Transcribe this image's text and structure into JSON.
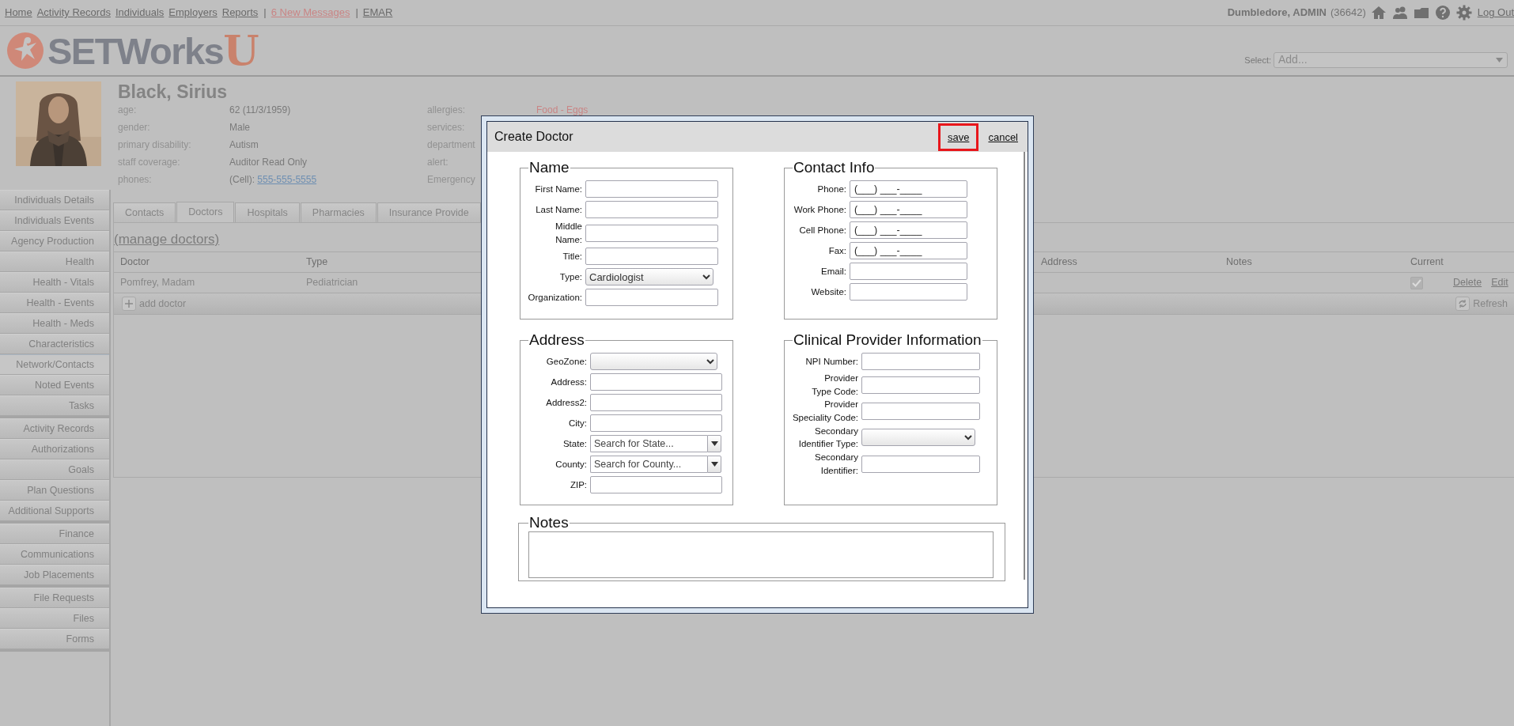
{
  "top_nav": {
    "links": [
      {
        "label": "Home",
        "kind": "link"
      },
      {
        "label": "Activity Records",
        "kind": "link"
      },
      {
        "label": "Individuals",
        "kind": "link"
      },
      {
        "label": "Employers",
        "kind": "link"
      },
      {
        "label": "Reports",
        "kind": "link"
      },
      {
        "label": "|",
        "kind": "separator"
      },
      {
        "label": "6 New Messages",
        "kind": "alert"
      },
      {
        "label": "|",
        "kind": "separator"
      },
      {
        "label": "EMAR",
        "kind": "link"
      }
    ],
    "user": "Dumbledore, ADMIN",
    "user_id": "(36642)",
    "logout": "Log Out"
  },
  "header": {
    "logo_text": "SETWorks",
    "logo_mark": "U",
    "select_label": "Select:",
    "select_placeholder": "Add..."
  },
  "profile": {
    "name": "Black, Sirius",
    "details": [
      {
        "label": "age:",
        "value": "62 (11/3/1959)"
      },
      {
        "label": "gender:",
        "value": "Male"
      },
      {
        "label": "primary disability:",
        "value": "Autism"
      },
      {
        "label": "staff coverage:",
        "value": "Auditor Read Only"
      },
      {
        "label": "phones:",
        "value": "(Cell):",
        "link": "555-555-5555"
      }
    ],
    "details_2": [
      {
        "label": "allergies:",
        "value": "Food - Eggs",
        "kind": "alert"
      },
      {
        "label": "services:"
      },
      {
        "label": "department"
      },
      {
        "label": "alert:"
      },
      {
        "label": "Emergency"
      }
    ]
  },
  "sidebar": {
    "groups": [
      {
        "items": [
          {
            "label": "Individuals Details",
            "selected": false
          },
          {
            "label": "Individuals Events",
            "selected": false
          },
          {
            "label": "Agency Production",
            "selected": false
          },
          {
            "label": "Health",
            "selected": false
          },
          {
            "label": "Health - Vitals",
            "selected": false
          },
          {
            "label": "Health - Events",
            "selected": false
          },
          {
            "label": "Health - Meds",
            "selected": false
          },
          {
            "label": "Characteristics",
            "selected": false
          },
          {
            "label": "Network/Contacts",
            "selected": true
          },
          {
            "label": "Noted Events",
            "selected": false
          },
          {
            "label": "Tasks",
            "selected": false
          }
        ]
      },
      {
        "items": [
          {
            "label": "Activity Records",
            "selected": false
          },
          {
            "label": "Authorizations",
            "selected": false
          },
          {
            "label": "Goals",
            "selected": false
          },
          {
            "label": "Plan Questions",
            "selected": false
          },
          {
            "label": "Additional Supports",
            "selected": false
          }
        ]
      },
      {
        "items": [
          {
            "label": "Finance",
            "selected": false
          },
          {
            "label": "Communications",
            "selected": false
          },
          {
            "label": "Job Placements",
            "selected": false
          }
        ]
      },
      {
        "items": [
          {
            "label": "File Requests",
            "selected": false
          },
          {
            "label": "Files",
            "selected": false
          },
          {
            "label": "Forms",
            "selected": false
          }
        ]
      }
    ]
  },
  "tabs": [
    {
      "label": "Contacts",
      "selected": false
    },
    {
      "label": "Doctors",
      "selected": true
    },
    {
      "label": "Hospitals",
      "selected": false
    },
    {
      "label": "Pharmacies",
      "selected": false
    },
    {
      "label": "Insurance Provide",
      "selected": false
    }
  ],
  "manage_link": "(manage doctors)",
  "table": {
    "columns": [
      {
        "label": "Doctor"
      },
      {
        "label": "Type"
      },
      {
        "label": "Address"
      },
      {
        "label": "Notes"
      },
      {
        "label": "Current"
      }
    ],
    "rows": [
      {
        "doctor": "Pomfrey, Madam",
        "type": "Pediatrician",
        "current": true,
        "actions": [
          "Delete",
          "Edit"
        ]
      }
    ],
    "add_label": "add doctor",
    "refresh_label": "Refresh"
  },
  "dialog": {
    "title": "Create Doctor",
    "actions": [
      {
        "label": "save",
        "highlighted": true
      },
      {
        "label": "cancel",
        "highlighted": false
      }
    ],
    "sections": [
      {
        "title": "Name",
        "fields": [
          {
            "label": "First Name:",
            "kind": "text"
          },
          {
            "label": "Last Name:",
            "kind": "text"
          },
          {
            "label": "Middle\nName:",
            "kind": "text"
          },
          {
            "label": "Title:",
            "kind": "text"
          },
          {
            "label": "Type:",
            "kind": "select",
            "value": "Cardiologist"
          },
          {
            "label": "Organization:",
            "kind": "text"
          }
        ]
      },
      {
        "title": "Contact Info",
        "fields": [
          {
            "label": "Phone:",
            "kind": "phone",
            "value": "(___) ___-____"
          },
          {
            "label": "Work Phone:",
            "kind": "phone",
            "value": "(___) ___-____"
          },
          {
            "label": "Cell Phone:",
            "kind": "phone",
            "value": "(___) ___-____"
          },
          {
            "label": "Fax:",
            "kind": "phone",
            "value": "(___) ___-____"
          },
          {
            "label": "Email:",
            "kind": "text"
          },
          {
            "label": "Website:",
            "kind": "text"
          }
        ]
      },
      {
        "title": "Address",
        "fields": [
          {
            "label": "GeoZone:",
            "kind": "select"
          },
          {
            "label": "Address:",
            "kind": "text"
          },
          {
            "label": "Address2:",
            "kind": "text"
          },
          {
            "label": "City:",
            "kind": "text"
          },
          {
            "label": "State:",
            "kind": "combo",
            "placeholder": "Search for State..."
          },
          {
            "label": "County:",
            "kind": "combo",
            "placeholder": "Search for County..."
          },
          {
            "label": "ZIP:",
            "kind": "text"
          }
        ]
      },
      {
        "title": "Clinical Provider Information",
        "fields": [
          {
            "label": "NPI Number:",
            "kind": "text"
          },
          {
            "label": "Provider\nType Code:",
            "kind": "text"
          },
          {
            "label": "Provider\nSpeciality Code:",
            "kind": "text"
          },
          {
            "label": "Secondary\nIdentifier Type:",
            "kind": "select"
          },
          {
            "label": "Secondary\nIdentifier:",
            "kind": "text"
          }
        ]
      }
    ],
    "notes_title": "Notes"
  }
}
